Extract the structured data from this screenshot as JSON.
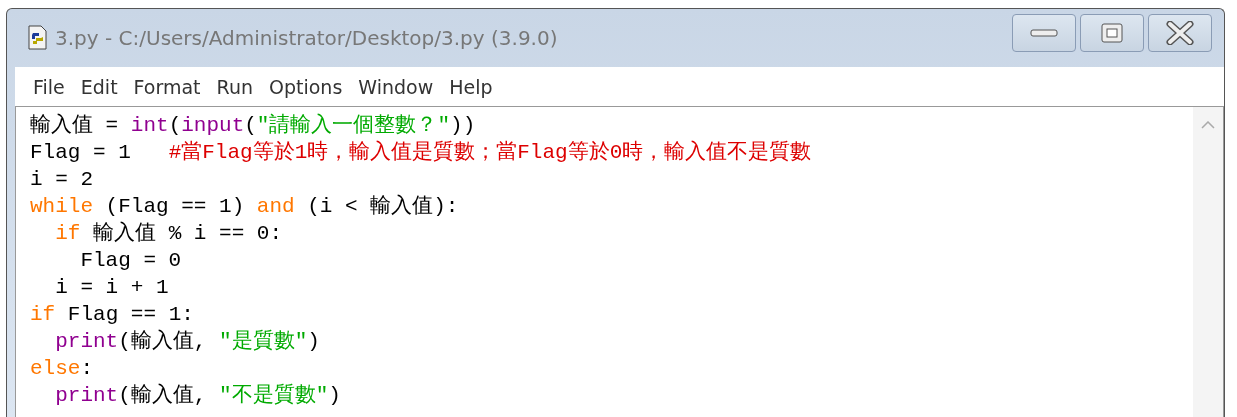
{
  "window": {
    "title": "3.py - C:/Users/Administrator/Desktop/3.py (3.9.0)"
  },
  "menu": [
    "File",
    "Edit",
    "Format",
    "Run",
    "Options",
    "Window",
    "Help"
  ],
  "code_lines": [
    [
      {
        "kind": "plain",
        "text": "輸入值 = "
      },
      {
        "kind": "builtin",
        "text": "int"
      },
      {
        "kind": "plain",
        "text": "("
      },
      {
        "kind": "builtin",
        "text": "input"
      },
      {
        "kind": "plain",
        "text": "("
      },
      {
        "kind": "string",
        "text": "\"請輸入一個整數？\""
      },
      {
        "kind": "plain",
        "text": "))"
      }
    ],
    [
      {
        "kind": "plain",
        "text": "Flag = 1   "
      },
      {
        "kind": "comment",
        "text": "#當Flag等於1時，輸入值是質數；當Flag等於0時，輸入值不是質數"
      }
    ],
    [
      {
        "kind": "plain",
        "text": "i = 2"
      }
    ],
    [
      {
        "kind": "keyword",
        "text": "while"
      },
      {
        "kind": "plain",
        "text": " (Flag == 1) "
      },
      {
        "kind": "keyword",
        "text": "and"
      },
      {
        "kind": "plain",
        "text": " (i < 輸入值):"
      }
    ],
    [
      {
        "kind": "keyword",
        "text": "  if"
      },
      {
        "kind": "plain",
        "text": " 輸入值 % i == 0:"
      }
    ],
    [
      {
        "kind": "plain",
        "text": "    Flag = 0"
      }
    ],
    [
      {
        "kind": "plain",
        "text": "  i = i + 1"
      }
    ],
    [
      {
        "kind": "keyword",
        "text": "if"
      },
      {
        "kind": "plain",
        "text": " Flag == 1:"
      }
    ],
    [
      {
        "kind": "builtin",
        "text": "  print"
      },
      {
        "kind": "plain",
        "text": "(輸入值, "
      },
      {
        "kind": "string",
        "text": "\"是質數\""
      },
      {
        "kind": "plain",
        "text": ")"
      }
    ],
    [
      {
        "kind": "keyword",
        "text": "else"
      },
      {
        "kind": "plain",
        "text": ":"
      }
    ],
    [
      {
        "kind": "builtin",
        "text": "  print"
      },
      {
        "kind": "plain",
        "text": "(輸入值, "
      },
      {
        "kind": "string",
        "text": "\"不是質數\""
      },
      {
        "kind": "plain",
        "text": ")"
      }
    ]
  ]
}
